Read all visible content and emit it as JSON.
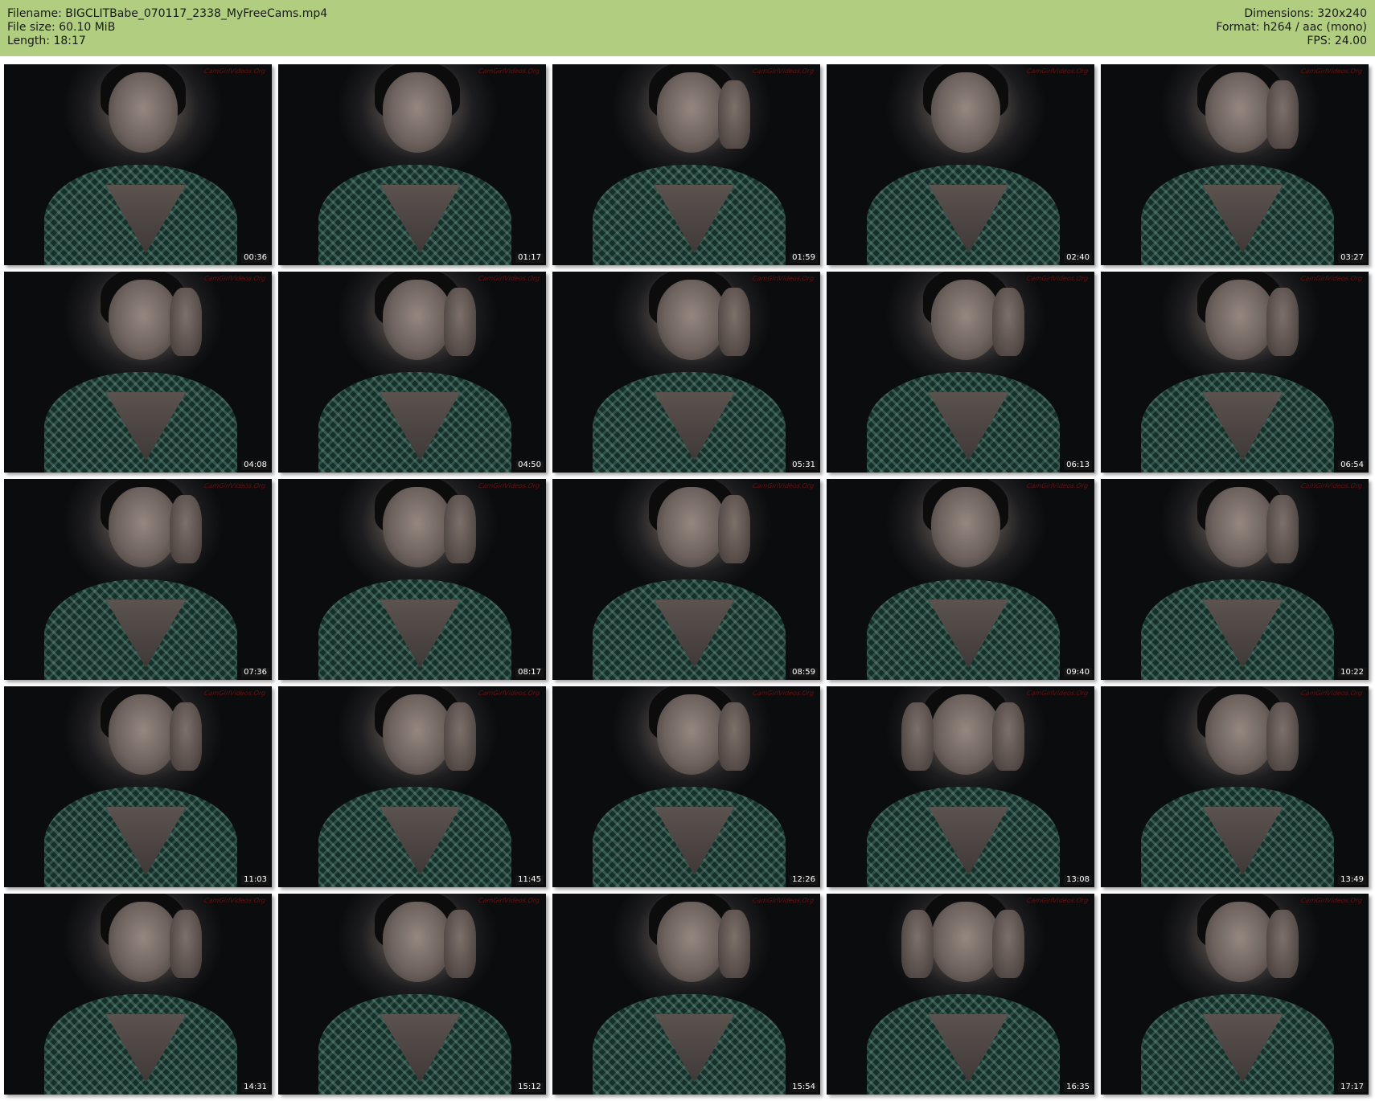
{
  "header": {
    "filename_label": "Filename: BIGCLITBabe_070117_2338_MyFreeCams.mp4",
    "filesize_label": "File size: 60.10 MiB",
    "length_label": "Length: 18:17",
    "dimensions_label": "Dimensions: 320x240",
    "format_label": "Format: h264 / aac (mono)",
    "fps_label": "FPS: 24.00"
  },
  "thumbnails": [
    {
      "timestamp": "00:36"
    },
    {
      "timestamp": "01:17"
    },
    {
      "timestamp": "01:59"
    },
    {
      "timestamp": "02:40"
    },
    {
      "timestamp": "03:27"
    },
    {
      "timestamp": "04:08"
    },
    {
      "timestamp": "04:50"
    },
    {
      "timestamp": "05:31"
    },
    {
      "timestamp": "06:13"
    },
    {
      "timestamp": "06:54"
    },
    {
      "timestamp": "07:36"
    },
    {
      "timestamp": "08:17"
    },
    {
      "timestamp": "08:59"
    },
    {
      "timestamp": "09:40"
    },
    {
      "timestamp": "10:22"
    },
    {
      "timestamp": "11:03"
    },
    {
      "timestamp": "11:45"
    },
    {
      "timestamp": "12:26"
    },
    {
      "timestamp": "13:08"
    },
    {
      "timestamp": "13:49"
    },
    {
      "timestamp": "14:31"
    },
    {
      "timestamp": "15:12"
    },
    {
      "timestamp": "15:54"
    },
    {
      "timestamp": "16:35"
    },
    {
      "timestamp": "17:17"
    }
  ],
  "watermark_text": "CamGirlVideos.Org",
  "colors": {
    "header_bg": "#b1cd80",
    "page_bg": "#ffffff",
    "timestamp_bg": "#141414"
  }
}
